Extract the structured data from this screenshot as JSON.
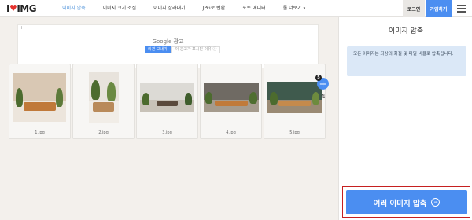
{
  "logo": {
    "left": "I",
    "right": "IMG"
  },
  "nav": {
    "items": [
      {
        "label": "이미지 압축",
        "active": true
      },
      {
        "label": "이미지 크기 조절",
        "active": false
      },
      {
        "label": "이미지 잘라내기",
        "active": false
      },
      {
        "label": "JPG로 변환",
        "active": false
      },
      {
        "label": "포토 에디터",
        "active": false
      },
      {
        "label": "툴 더보기",
        "active": false,
        "caret": "▾"
      }
    ],
    "login": "로그인",
    "signup": "가입하기"
  },
  "ad": {
    "corner": "+",
    "title_brand": "Google",
    "title_text": " 광고",
    "feedback_label": "의견 보내기",
    "why_label": "이 광고가 표시된 이유 ⓘ"
  },
  "files": [
    {
      "name": "1.jpg"
    },
    {
      "name": "2.jpg"
    },
    {
      "name": "3.jpg"
    },
    {
      "name": "4.jpg"
    },
    {
      "name": "5.jpg"
    }
  ],
  "add": {
    "symbol": "+",
    "count": "5"
  },
  "sort_icon": "⇅",
  "sidebar": {
    "title": "이미지 압축",
    "info": "모든 이미지는 최상의 화질 및 파일 비율로 압축됩니다.",
    "cta_label": "여러 이미지 압축",
    "cta_arrow": "→"
  },
  "colors": {
    "accent": "#4b8ef1",
    "brand_red": "#e5322d",
    "info_bg": "#dbe8f7"
  }
}
